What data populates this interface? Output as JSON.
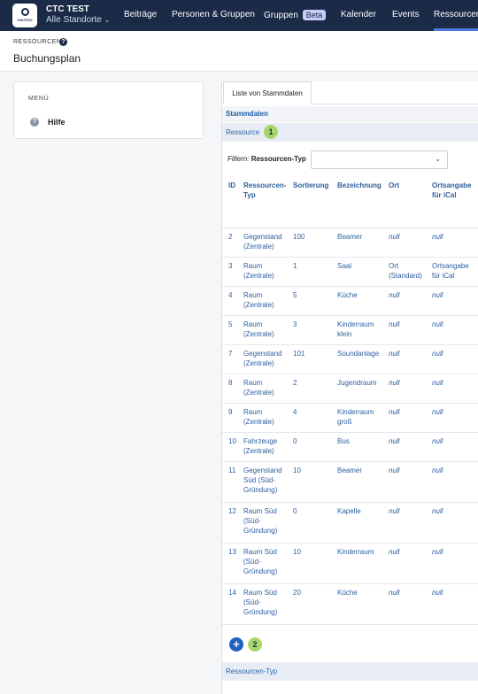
{
  "nav": {
    "logo_text": "CHUTOO",
    "org_name": "CTC TEST",
    "org_location": "Alle Standorte",
    "items": [
      "Beiträge",
      "Personen & Gruppen",
      "Gruppen",
      "Kalender",
      "Events",
      "Ressourcen"
    ],
    "beta_label": "Beta",
    "active": "Ressourcen"
  },
  "header": {
    "breadcrumb": "RESSOURCEN",
    "title": "Buchungsplan"
  },
  "menu": {
    "title": "MENÜ",
    "items": [
      {
        "label": "Hilfe",
        "icon": "question-icon"
      }
    ]
  },
  "panel": {
    "tab": "Liste von Stammdaten",
    "section_title": "Stammdaten",
    "subsection": "Ressource",
    "badge1": "1",
    "badge2": "2",
    "filter_label_prefix": "Filtern:",
    "filter_label": "Ressourcen-Typ",
    "filter_value": "",
    "bottom_section": "Ressourcen-Typ",
    "columns": [
      [
        "ID"
      ],
      [
        "Ressourcen-",
        "Typ"
      ],
      [
        "Sortierung"
      ],
      [
        "Bezeichnung"
      ],
      [
        "Ort"
      ],
      [
        "Ortsangabe",
        "für iCal"
      ]
    ],
    "rows": [
      {
        "id": "2",
        "typ": [
          "Gegenstand",
          "(Zentrale)"
        ],
        "sort": "100",
        "bez": [
          "Beamer"
        ],
        "ort": [
          "null"
        ],
        "ical": [
          "null"
        ]
      },
      {
        "id": "3",
        "typ": [
          "Raum",
          "(Zentrale)"
        ],
        "sort": "1",
        "bez": [
          "Saal"
        ],
        "ort": [
          "Ort",
          "(Standard)"
        ],
        "ical": [
          "Ortsangabe",
          "für iCal"
        ]
      },
      {
        "id": "4",
        "typ": [
          "Raum",
          "(Zentrale)"
        ],
        "sort": "5",
        "bez": [
          "Küche"
        ],
        "ort": [
          "null"
        ],
        "ical": [
          "null"
        ]
      },
      {
        "id": "5",
        "typ": [
          "Raum",
          "(Zentrale)"
        ],
        "sort": "3",
        "bez": [
          "Kinderraum",
          "klein"
        ],
        "ort": [
          "null"
        ],
        "ical": [
          "null"
        ]
      },
      {
        "id": "7",
        "typ": [
          "Gegenstand",
          "(Zentrale)"
        ],
        "sort": "101",
        "bez": [
          "Soundanlage"
        ],
        "ort": [
          "null"
        ],
        "ical": [
          "null"
        ]
      },
      {
        "id": "8",
        "typ": [
          "Raum",
          "(Zentrale)"
        ],
        "sort": "2",
        "bez": [
          "Jugendraum"
        ],
        "ort": [
          "null"
        ],
        "ical": [
          "null"
        ]
      },
      {
        "id": "9",
        "typ": [
          "Raum",
          "(Zentrale)"
        ],
        "sort": "4",
        "bez": [
          "Kinderraum",
          "groß"
        ],
        "ort": [
          "null"
        ],
        "ical": [
          "null"
        ]
      },
      {
        "id": "10",
        "typ": [
          "Fahrzeuge",
          "(Zentrale)"
        ],
        "sort": "0",
        "bez": [
          "Bus"
        ],
        "ort": [
          "null"
        ],
        "ical": [
          "null"
        ]
      },
      {
        "id": "11",
        "typ": [
          "Gegenstand",
          "Süd (Süd-",
          "Gründung)"
        ],
        "sort": "10",
        "bez": [
          "Beamer"
        ],
        "ort": [
          "null"
        ],
        "ical": [
          "null"
        ]
      },
      {
        "id": "12",
        "typ": [
          "Raum Süd",
          "(Süd-",
          "Gründung)"
        ],
        "sort": "0",
        "bez": [
          "Kapelle"
        ],
        "ort": [
          "null"
        ],
        "ical": [
          "null"
        ]
      },
      {
        "id": "13",
        "typ": [
          "Raum Süd",
          "(Süd-",
          "Gründung)"
        ],
        "sort": "10",
        "bez": [
          "Kinderraum"
        ],
        "ort": [
          "null"
        ],
        "ical": [
          "null"
        ]
      },
      {
        "id": "14",
        "typ": [
          "Raum Süd",
          "(Süd-",
          "Gründung)"
        ],
        "sort": "20",
        "bez": [
          "Küche"
        ],
        "ort": [
          "null"
        ],
        "ical": [
          "null"
        ]
      }
    ]
  }
}
